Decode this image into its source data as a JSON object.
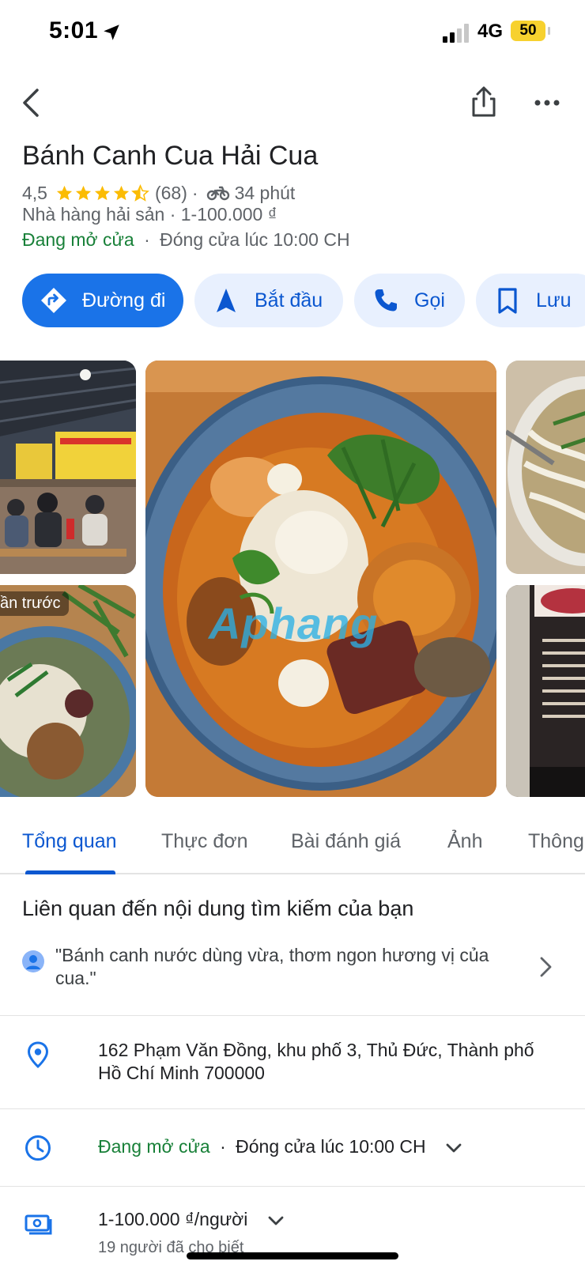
{
  "status_bar": {
    "time": "5:01",
    "network": "4G",
    "battery": "50"
  },
  "place": {
    "title": "Bánh Canh Cua Hải Cua",
    "rating": "4,5",
    "stars": 4.5,
    "review_count": "(68)",
    "travel_time": "34 phút",
    "category": "Nhà hàng hải sản · 1-100.000 ₫",
    "open_status": "Đang mở cửa",
    "closing": "Đóng cửa lúc 10:00 CH"
  },
  "actions": {
    "directions": "Đường đi",
    "start": "Bắt đầu",
    "call": "Gọi",
    "save": "Lưu"
  },
  "photos": {
    "recent_label": "ần trước",
    "watermark": "Aphang"
  },
  "tabs": [
    "Tổng quan",
    "Thực đơn",
    "Bài đánh giá",
    "Ảnh",
    "Thông"
  ],
  "related": {
    "heading": "Liên quan đến nội dung tìm kiếm của bạn",
    "quote": "\"Bánh canh nước dùng vừa, thơm ngon hương vị của cua.\""
  },
  "info": {
    "address": "162 Phạm Văn Đồng, khu phố 3, Thủ Đức, Thành phố Hồ Chí Minh 700000",
    "hours_open": "Đang mở cửa",
    "hours_closing": "Đóng cửa lúc 10:00 CH",
    "price": "1-100.000 ₫/người",
    "price_reports": "19 người đã cho biết"
  },
  "colors": {
    "accent": "#0b57d0",
    "primary_button": "#1a73e8",
    "chip_bg": "#e8f0fe",
    "open_green": "#188038",
    "star": "#fbbc04",
    "battery": "#f7d12e"
  }
}
